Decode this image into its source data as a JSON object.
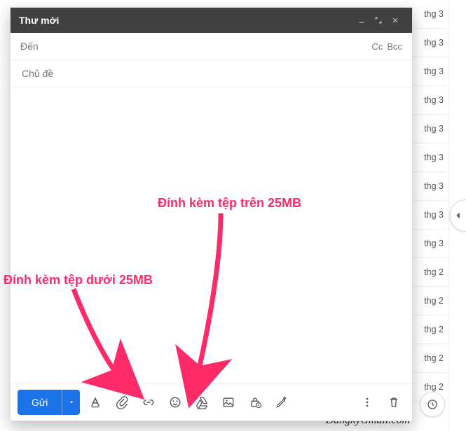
{
  "compose": {
    "title": "Thư mới",
    "to_label": "Đến",
    "cc": "Cc",
    "bcc": "Bcc",
    "subject_placeholder": "Chủ đề",
    "send": "Gửi"
  },
  "annotations": {
    "under25": "Đính kèm tệp dưới 25MB",
    "over25": "Đính kèm tệp trên 25MB"
  },
  "bg_list": [
    "thg 3",
    "thg 3",
    "thg 3",
    "thg 3",
    "thg 3",
    "thg 3",
    "thg 3",
    "thg 3",
    "thg 3",
    "thg 2",
    "thg 2",
    "thg 2",
    "thg 2",
    "thg 2"
  ],
  "watermark": "DangkyGmail.com",
  "colors": {
    "accent": "#1a73e8",
    "annotation": "#ff2a68"
  }
}
